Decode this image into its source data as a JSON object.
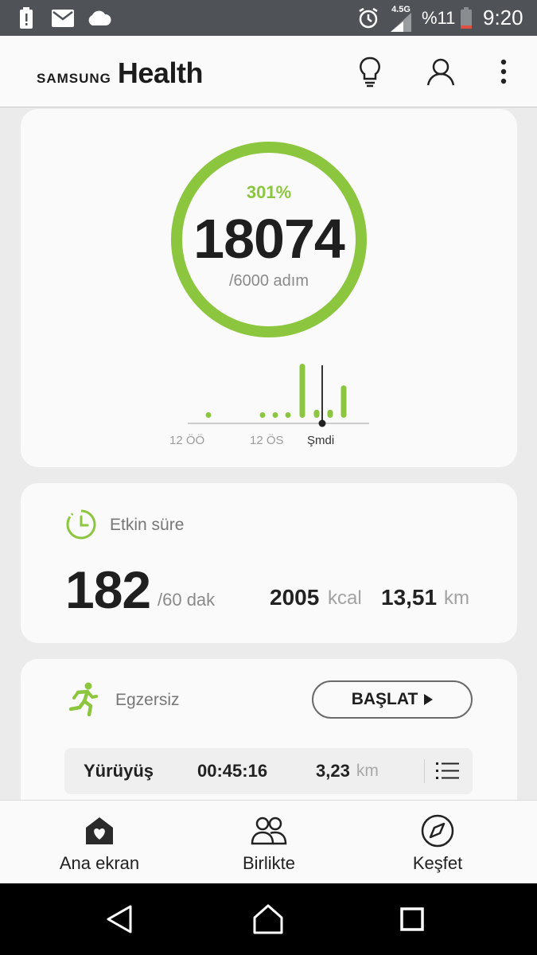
{
  "status_bar": {
    "network": "4.5G",
    "battery_percent": "%11",
    "time": "9:20",
    "icons": [
      "battery-alert-icon",
      "mail-icon",
      "cloud-icon",
      "alarm-icon",
      "signal-icon",
      "battery-icon"
    ]
  },
  "app_bar": {
    "logo_samsung": "SAMSUNG",
    "logo_health": "Health",
    "icons": [
      "lightbulb-icon",
      "profile-icon",
      "more-options-icon"
    ]
  },
  "steps_card": {
    "percent": "301%",
    "count": "18074",
    "goal": "/6000 adım",
    "progress_fraction": 1.0,
    "ring_color": "#8cc63f",
    "timeline": {
      "ticks": [
        "12 ÖÖ",
        "12 ÖS",
        "Şmdi"
      ],
      "activity_levels": [
        0.1,
        0.1,
        0.1,
        0.1,
        1.0,
        0.15,
        0.15,
        0.6
      ]
    }
  },
  "active_card": {
    "title": "Etkin süre",
    "value": "182",
    "goal": "/60 dak",
    "calories_value": "2005",
    "calories_unit": "kcal",
    "distance_value": "13,51",
    "distance_unit": "km"
  },
  "exercise_card": {
    "title": "Egzersiz",
    "start_label": "BAŞLAT",
    "workout": {
      "type": "Yürüyüş",
      "duration": "00:45:16",
      "distance_value": "3,23",
      "distance_unit": "km"
    }
  },
  "bottom_nav": {
    "tabs": [
      {
        "label": "Ana ekran",
        "icon": "home-heart-icon"
      },
      {
        "label": "Birlikte",
        "icon": "people-icon"
      },
      {
        "label": "Keşfet",
        "icon": "compass-icon"
      }
    ]
  },
  "system_nav": {
    "icons": [
      "back-icon",
      "home-icon",
      "recents-icon"
    ]
  },
  "colors": {
    "accent": "#8cc63f",
    "status_bar": "#4f5357",
    "background": "#ebebeb"
  }
}
